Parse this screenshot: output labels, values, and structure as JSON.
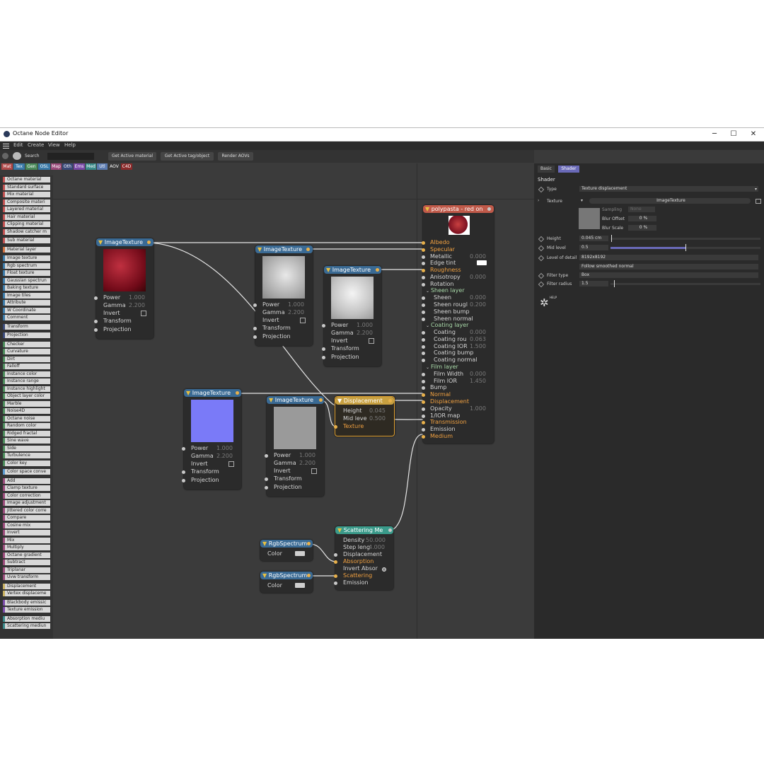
{
  "window": {
    "title": "Octane Node Editor",
    "min": "─",
    "max": "☐",
    "close": "✕"
  },
  "menu": [
    "Edit",
    "Create",
    "View",
    "Help"
  ],
  "toolbar": {
    "search_label": "Search",
    "get_active_material": "Get Active material",
    "get_active_tag": "Get Active tag/object",
    "render_aovs": "Render AOVs"
  },
  "category_tabs": [
    {
      "label": "Mat",
      "color": "#b04a4a"
    },
    {
      "label": "Tex",
      "color": "#3a7aa8"
    },
    {
      "label": "Gen",
      "color": "#4a8a5a"
    },
    {
      "label": "OSL",
      "color": "#3a7aa8"
    },
    {
      "label": "Map",
      "color": "#9a4a7a"
    },
    {
      "label": "Oth",
      "color": "#3a4a7a"
    },
    {
      "label": "Ems",
      "color": "#7a4aa8"
    },
    {
      "label": "Med",
      "color": "#3a8a8a"
    },
    {
      "label": "Utl",
      "color": "#5a7ab0"
    },
    {
      "label": "AOV",
      "color": "#3a3a3a"
    },
    {
      "label": "C4D",
      "color": "#8a2a2a"
    }
  ],
  "node_list": [
    {
      "label": "Octane material",
      "color": "#c05050"
    },
    {
      "label": "Standard surface",
      "color": "#c05050"
    },
    {
      "label": "Mix material",
      "color": "#c05050"
    },
    {
      "label": "Composite materi",
      "color": "#c05050"
    },
    {
      "label": "Layered material",
      "color": "#c05050"
    },
    {
      "label": "Hair material",
      "color": "#c05050"
    },
    {
      "label": "Clipping material",
      "color": "#c05050"
    },
    {
      "label": "Shadow catcher m",
      "color": "#c05050"
    },
    {
      "label": "Sub material",
      "color": "#c05050"
    },
    {
      "label": "Material layer",
      "color": "#d07040"
    },
    {
      "label": "Image texture",
      "color": "#3a7aa8"
    },
    {
      "label": "Rgb spectrum",
      "color": "#3a7aa8"
    },
    {
      "label": "Float texture",
      "color": "#3a7aa8"
    },
    {
      "label": "Gaussian spectrun",
      "color": "#3a7aa8"
    },
    {
      "label": "Baking texture",
      "color": "#3a7aa8"
    },
    {
      "label": "Image tiles",
      "color": "#3a7aa8"
    },
    {
      "label": "Attribute",
      "color": "#3a7aa8"
    },
    {
      "label": "W Coordinate",
      "color": "#3a7aa8"
    },
    {
      "label": "Comment",
      "color": "#3a7aa8"
    },
    {
      "label": "Transform",
      "color": "#3a4a7a"
    },
    {
      "label": "Projection",
      "color": "#3a4a7a"
    },
    {
      "label": "Checker",
      "color": "#4a8a5a"
    },
    {
      "label": "Curvature",
      "color": "#4a8a5a"
    },
    {
      "label": "Dirt",
      "color": "#4a8a5a"
    },
    {
      "label": "Falloff",
      "color": "#4a8a5a"
    },
    {
      "label": "Instance color",
      "color": "#4a8a5a"
    },
    {
      "label": "Instance range",
      "color": "#4a8a5a"
    },
    {
      "label": "Instance highlight",
      "color": "#4a8a5a"
    },
    {
      "label": "Object layer color",
      "color": "#4a8a5a"
    },
    {
      "label": "Marble",
      "color": "#4a8a5a"
    },
    {
      "label": "Noise4D",
      "color": "#4a8a5a"
    },
    {
      "label": "Octane noise",
      "color": "#4a8a5a"
    },
    {
      "label": "Random color",
      "color": "#4a8a5a"
    },
    {
      "label": "Ridged fractal",
      "color": "#4a8a5a"
    },
    {
      "label": "Sine wave",
      "color": "#4a8a5a"
    },
    {
      "label": "Side",
      "color": "#4a8a5a"
    },
    {
      "label": "Turbulence",
      "color": "#4a8a5a"
    },
    {
      "label": "Color key",
      "color": "#4a8a5a"
    },
    {
      "label": "Color space conve",
      "color": "#5a9ad0"
    },
    {
      "label": "Add",
      "color": "#9a4a7a"
    },
    {
      "label": "Clamp texture",
      "color": "#9a4a7a"
    },
    {
      "label": "Color correction",
      "color": "#9a4a7a"
    },
    {
      "label": "Image adjustment",
      "color": "#9a4a7a"
    },
    {
      "label": "Jittered color corre",
      "color": "#9a4a7a"
    },
    {
      "label": "Compare",
      "color": "#9a4a7a"
    },
    {
      "label": "Cosine mix",
      "color": "#9a4a7a"
    },
    {
      "label": "Invert",
      "color": "#9a4a7a"
    },
    {
      "label": "Mix",
      "color": "#9a4a7a"
    },
    {
      "label": "Multiply",
      "color": "#9a4a7a"
    },
    {
      "label": "Octane gradient",
      "color": "#9a4a7a"
    },
    {
      "label": "Subtract",
      "color": "#9a4a7a"
    },
    {
      "label": "Triplanar",
      "color": "#9a4a7a"
    },
    {
      "label": "Uvw transform",
      "color": "#9a4a7a"
    },
    {
      "label": "Displacement",
      "color": "#c8b060"
    },
    {
      "label": "Vertex displaceme",
      "color": "#c8b060"
    },
    {
      "label": "Blackbody emissic",
      "color": "#7a4aa8"
    },
    {
      "label": "Texture emission",
      "color": "#7a4aa8"
    },
    {
      "label": "Absorption mediu",
      "color": "#3a8a8a"
    },
    {
      "label": "Scattering mediun",
      "color": "#3a8a8a"
    }
  ],
  "nodes": {
    "img1": {
      "title": "ImageTexture",
      "power_label": "Power",
      "power": "1.000",
      "gamma_label": "Gamma",
      "gamma": "2.200",
      "invert_label": "Invert",
      "transform_label": "Transform",
      "projection_label": "Projection"
    },
    "img2": {
      "title": "ImageTexture",
      "power_label": "Power",
      "power": "1.000",
      "gamma_label": "Gamma",
      "gamma": "2.200",
      "invert_label": "Invert",
      "transform_label": "Transform",
      "projection_label": "Projection"
    },
    "img3": {
      "title": "ImageTexture",
      "power_label": "Power",
      "power": "1.000",
      "gamma_label": "Gamma",
      "gamma": "2.200",
      "invert_label": "Invert",
      "transform_label": "Transform",
      "projection_label": "Projection"
    },
    "img4": {
      "title": "ImageTexture",
      "power_label": "Power",
      "power": "1.000",
      "gamma_label": "Gamma",
      "gamma": "2.200",
      "invert_label": "Invert",
      "transform_label": "Transform",
      "projection_label": "Projection"
    },
    "img5": {
      "title": "ImageTexture",
      "power_label": "Power",
      "power": "1.000",
      "gamma_label": "Gamma",
      "gamma": "2.200",
      "invert_label": "Invert",
      "transform_label": "Transform",
      "projection_label": "Projection"
    },
    "disp": {
      "title": "Displacement",
      "height_label": "Height",
      "height": "0.045",
      "mid_label": "Mid leve",
      "mid": "0.500",
      "texture_label": "Texture"
    },
    "scatter": {
      "title": "Scattering Me",
      "density_label": "Density",
      "density": "50.000",
      "step_label": "Step leng",
      "step": "4.000",
      "displacement_label": "Displacement",
      "absorption_label": "Absorption",
      "invert_label": "Invert Absor",
      "scattering_label": "Scattering",
      "emission_label": "Emission"
    },
    "rgb1": {
      "title": "RgbSpectrum",
      "color_label": "Color"
    },
    "rgb2": {
      "title": "RgbSpectrum",
      "color_label": "Color"
    },
    "material": {
      "title": "polypasta - red on",
      "rows": [
        {
          "label": "Albedo",
          "value": "",
          "style": "orange"
        },
        {
          "label": "Specular",
          "value": "",
          "style": "orange"
        },
        {
          "label": "Metallic",
          "value": "0.000",
          "style": ""
        },
        {
          "label": "Edge tint",
          "value": "",
          "style": ""
        },
        {
          "label": "Roughness",
          "value": "",
          "style": "orange"
        },
        {
          "label": "Anisotropy",
          "value": "0.000",
          "style": ""
        },
        {
          "label": "Rotation",
          "value": "",
          "style": ""
        },
        {
          "label": "Sheen layer",
          "value": "",
          "style": "group"
        },
        {
          "label": "Sheen",
          "value": "0.000",
          "style": "sub"
        },
        {
          "label": "Sheen rougl",
          "value": "0.200",
          "style": "sub"
        },
        {
          "label": "Sheen bump",
          "value": "",
          "style": "sub"
        },
        {
          "label": "Sheen normal",
          "value": "",
          "style": "sub"
        },
        {
          "label": "Coating layer",
          "value": "",
          "style": "group"
        },
        {
          "label": "Coating",
          "value": "0.000",
          "style": "sub"
        },
        {
          "label": "Coating rou",
          "value": "0.063",
          "style": "sub"
        },
        {
          "label": "Coating IOR",
          "value": "1.500",
          "style": "sub"
        },
        {
          "label": "Coating bump",
          "value": "",
          "style": "sub"
        },
        {
          "label": "Coating normal",
          "value": "",
          "style": "sub"
        },
        {
          "label": "Film layer",
          "value": "",
          "style": "group"
        },
        {
          "label": "Film Width",
          "value": "0.000",
          "style": "sub"
        },
        {
          "label": "Film IOR",
          "value": "1.450",
          "style": "sub"
        },
        {
          "label": "Bump",
          "value": "",
          "style": ""
        },
        {
          "label": "Normal",
          "value": "",
          "style": "orange"
        },
        {
          "label": "Displacement",
          "value": "",
          "style": "orange"
        },
        {
          "label": "Opacity",
          "value": "1.000",
          "style": ""
        },
        {
          "label": "1/IOR map",
          "value": "",
          "style": ""
        },
        {
          "label": "Transmission",
          "value": "",
          "style": "orange"
        },
        {
          "label": "Emission",
          "value": "",
          "style": ""
        },
        {
          "label": "Medium",
          "value": "",
          "style": "orange"
        }
      ]
    }
  },
  "right_panel": {
    "tabs": [
      {
        "label": "Basic"
      },
      {
        "label": "Shader"
      }
    ],
    "section": "Shader",
    "type_label": "Type",
    "type_value": "Texture displacement",
    "texture_label": "Texture",
    "texture_value": "ImageTexture",
    "sampling_label": "Sampling",
    "sampling_value": "None",
    "blur_offset_label": "Blur Offset",
    "blur_offset_value": "0 %",
    "blur_scale_label": "Blur Scale",
    "blur_scale_value": "0 %",
    "height_label": "Height",
    "height_value": "0.045 cm",
    "mid_label": "Mid level",
    "mid_value": "0.5",
    "mid_fraction": 0.5,
    "lod_label": "Level of detail",
    "lod_value": "8192x8192",
    "normal_mode_value": "Follow smoothed normal",
    "filter_type_label": "Filter type",
    "filter_type_value": "Box",
    "filter_radius_label": "Filter radius",
    "filter_radius_value": "1.5",
    "help_label": "HELP"
  },
  "colors": {
    "accent_blue": "#3a7aa8",
    "material_head": "#c05a4a",
    "disp_head": "#c8a040",
    "scatter_head": "#3a9a8a",
    "wire": "#e0e0e0"
  }
}
